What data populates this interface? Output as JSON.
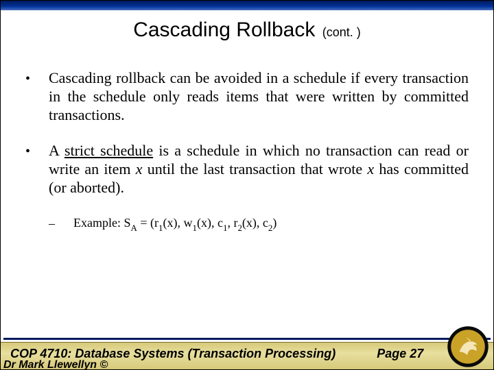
{
  "title": {
    "main": "Cascading Rollback",
    "cont": "(cont. )"
  },
  "bullets": [
    {
      "text": "Cascading rollback can be avoided in a schedule if every transaction in the schedule only reads items that were written by committed transactions."
    },
    {
      "pre": "A ",
      "underlined": "strict schedule",
      "mid": " is a schedule in which no transaction can read or write an item ",
      "italic1": "x",
      "mid2": " until the last transaction that wrote ",
      "italic2": "x",
      "post": " has committed (or aborted)."
    }
  ],
  "example": {
    "label": "Example: S",
    "labelSub": "A",
    "eq": " = (r",
    "s1": "1",
    "t1": "(x), w",
    "s2": "1",
    "t2": "(x), c",
    "s3": "1",
    "t3": ", r",
    "s4": "2",
    "t4": "(x), c",
    "s5": "2",
    "t5": ")"
  },
  "footer": {
    "course": "COP 4710: Database Systems  (Transaction Processing)",
    "page": "Page 27",
    "author": "Dr  Mark Llewellyn ©"
  }
}
